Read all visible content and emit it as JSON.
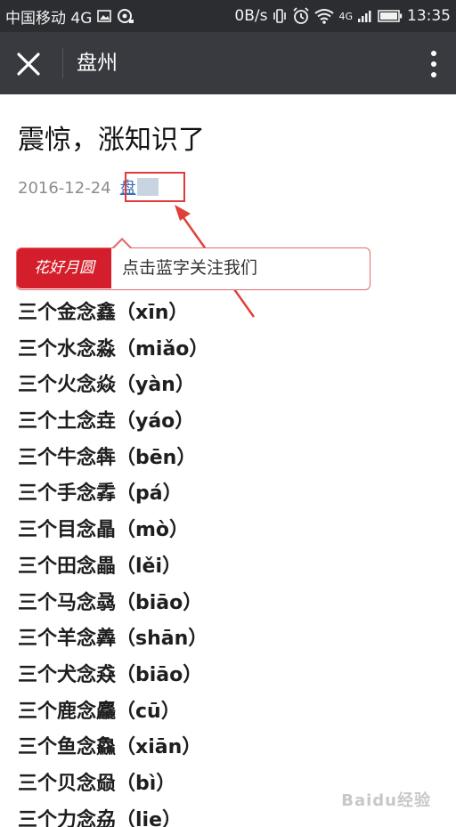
{
  "status_bar": {
    "carrier": "中国移动 4G",
    "speed": "0B/s",
    "network": "4G",
    "time": "13:35",
    "icons": [
      "image-icon",
      "sync-icon",
      "vibrate-icon",
      "alarm-icon",
      "wifi-icon",
      "signal-icon",
      "battery-icon"
    ]
  },
  "nav": {
    "title": "盘州",
    "icons": [
      "close-icon",
      "more-vertical-icon"
    ]
  },
  "article": {
    "title": "震惊，涨知识了",
    "date": "2016-12-24",
    "author": "盘"
  },
  "follow_banner": {
    "logo_text": "花好月圆",
    "text": "点击蓝字关注我们"
  },
  "items": [
    "三个金念鑫（xīn）",
    "三个水念淼（miǎo）",
    "三个火念焱（yàn）",
    "三个土念垚（yáo）",
    "三个牛念犇（bēn）",
    "三个手念掱（pá）",
    "三个目念瞐（mò）",
    "三个田念畾（lěi）",
    "三个马念骉（biāo）",
    "三个羊念羴（shān）",
    "三个犬念猋（biāo）",
    "三个鹿念麤（cū）",
    "三个鱼念鱻（xiān）",
    "三个贝念赑（bì）",
    "三个力念劦（lie）"
  ],
  "watermark": "Baidu经验",
  "colors": {
    "status_bar": "#2b2d31",
    "nav_bar": "#393a3f",
    "link": "#3b6db5",
    "highlight": "#e03a3a",
    "banner_logo": "#d51e2b"
  }
}
